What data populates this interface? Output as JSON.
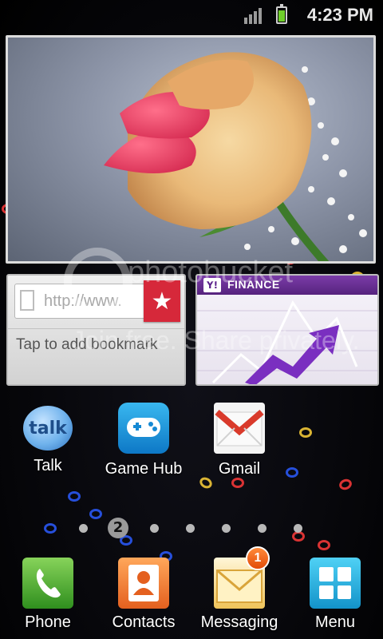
{
  "status_bar": {
    "time": "4:23 PM",
    "battery_color": "#6fcf2a"
  },
  "photo_widget": {
    "subject": "rose"
  },
  "bookmark_widget": {
    "url_placeholder": "http://www.",
    "hint": "Tap to add bookmark",
    "star_glyph": "★"
  },
  "finance_widget": {
    "logo": "Y!",
    "title": "FINANCE"
  },
  "watermark": {
    "brand": "photobucket",
    "tagline": "Join free. Share privately."
  },
  "home_apps": [
    {
      "label": "Talk",
      "icon_text": "talk"
    },
    {
      "label": "Game Hub"
    },
    {
      "label": "Gmail"
    }
  ],
  "page_indicator": {
    "current_page": "2",
    "total_pages": 7
  },
  "dock": [
    {
      "label": "Phone"
    },
    {
      "label": "Contacts"
    },
    {
      "label": "Messaging",
      "badge": "1"
    },
    {
      "label": "Menu"
    }
  ],
  "colors": {
    "finance_purple": "#5a1f8b",
    "bookmark_red": "#d6283a",
    "badge_orange": "#f06a14"
  }
}
